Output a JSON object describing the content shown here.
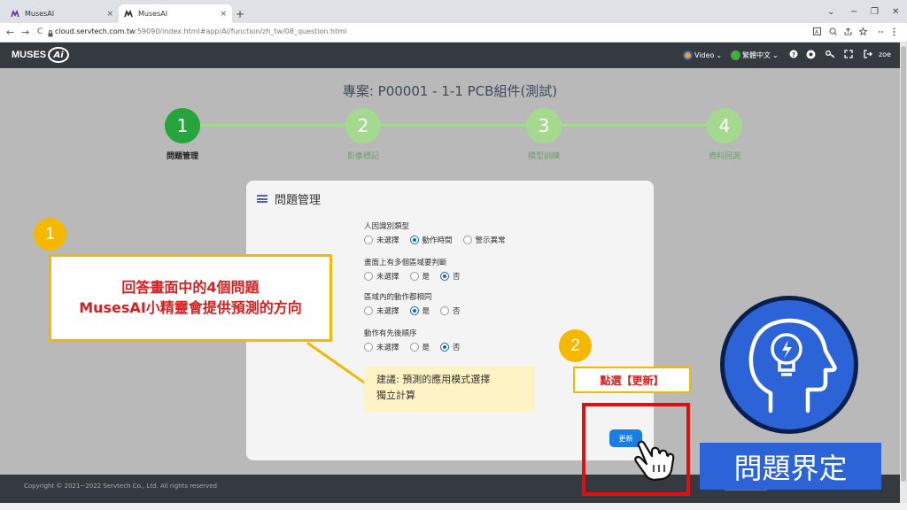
{
  "browser": {
    "tabs": [
      {
        "title": "MusesAI",
        "close": "×"
      },
      {
        "title": "MusesAI",
        "close": "×"
      }
    ],
    "new_tab": "+",
    "window_controls": [
      "⌄",
      "−",
      "❐",
      "✕"
    ],
    "url_host": "cloud.servtech.com.tw",
    "url_path": ":59090/index.html#app/AI/function/zh_tw/08_question.html",
    "nav": {
      "back": "←",
      "forward": "→",
      "reload": "C"
    }
  },
  "header": {
    "logo_text": "MUSES",
    "logo_ai": "Ai",
    "video_label": "Video",
    "language_label": "繁體中文",
    "user": "zoe"
  },
  "page": {
    "project_title": "專案: P00001 - 1-1 PCB組件(測試)",
    "steps": [
      {
        "number": "1",
        "label": "問題管理",
        "state": "active"
      },
      {
        "number": "2",
        "label": "影像標記",
        "state": "todo"
      },
      {
        "number": "3",
        "label": "模型訓練",
        "state": "todo"
      },
      {
        "number": "4",
        "label": "資料回測",
        "state": "todo"
      }
    ]
  },
  "card": {
    "title": "問題管理",
    "questions": [
      {
        "label": "人因識別類型",
        "options": [
          "未選擇",
          "動作時間",
          "警示異常"
        ],
        "selected": 1
      },
      {
        "label": "畫面上有多個區域要判斷",
        "options": [
          "未選擇",
          "是",
          "否"
        ],
        "selected": 2
      },
      {
        "label": "區域內的動作都相同",
        "options": [
          "未選擇",
          "是",
          "否"
        ],
        "selected": 1
      },
      {
        "label": "動作有先後順序",
        "options": [
          "未選擇",
          "是",
          "否"
        ],
        "selected": 2
      }
    ],
    "update_button": "更新"
  },
  "footer": {
    "copyright": "Copyright © 2021~2022 Servtech Co., Ltd. All rights reserved"
  },
  "annotations": {
    "badge_1": "1",
    "badge_2": "2",
    "callout_line1": "回答畫面中的4個問題",
    "callout_line2": "MusesAI小精靈會提供預測的方向",
    "suggestion_line1": "建議: 預測的應用模式選擇",
    "suggestion_line2": "獨立計算",
    "click_label": "點選【更新】",
    "section_label": "問題界定"
  }
}
